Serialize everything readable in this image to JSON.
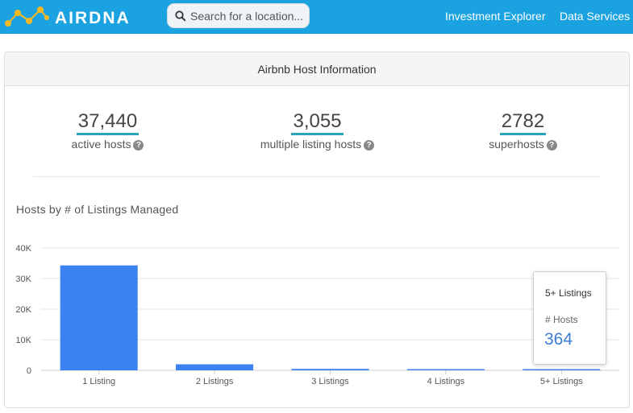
{
  "header": {
    "logo_text": "AIRDNA",
    "search_placeholder": "Search for a location...",
    "nav": [
      {
        "label": "Investment Explorer"
      },
      {
        "label": "Data Services"
      }
    ],
    "colors": {
      "bar": "#1aa3e0"
    }
  },
  "panel": {
    "title": "Airbnb Host Information",
    "stats": [
      {
        "value": "37,440",
        "label": "active hosts"
      },
      {
        "value": "3,055",
        "label": "multiple listing hosts"
      },
      {
        "value": "2782",
        "label": "superhosts"
      }
    ],
    "chart_title": "Hosts by # of Listings Managed",
    "tooltip": {
      "title": "5+ Listings",
      "label": "# Hosts",
      "value": "364"
    }
  },
  "chart_data": {
    "type": "bar",
    "categories": [
      "1 Listing",
      "2 Listings",
      "3 Listings",
      "4 Listings",
      "5+ Listings"
    ],
    "values": [
      34300,
      1970,
      470,
      250,
      364
    ],
    "ylim": [
      0,
      40000
    ],
    "yticks": [
      0,
      10000,
      20000,
      30000,
      40000
    ],
    "ytick_labels": [
      "0",
      "10K",
      "20K",
      "30K",
      "40K"
    ],
    "grid": true,
    "bar_color": "#3b82f0",
    "title": "Hosts by # of Listings Managed"
  }
}
